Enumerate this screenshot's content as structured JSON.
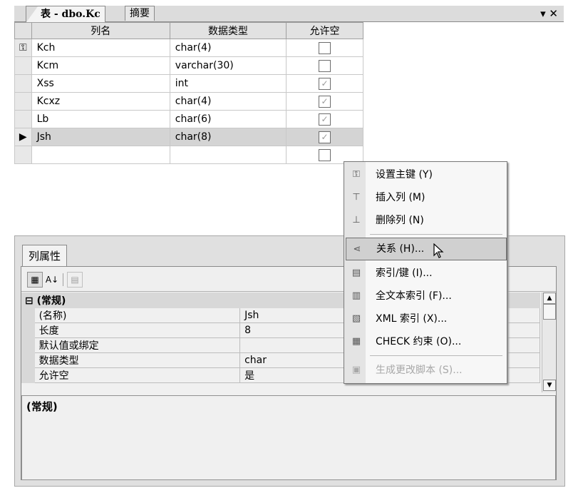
{
  "tabs": {
    "active": "表 - dbo.Kc",
    "summary": "摘要",
    "controls": "▾ ✕"
  },
  "grid": {
    "headers": [
      "列名",
      "数据类型",
      "允许空"
    ],
    "rows": [
      {
        "marker": "key",
        "name": "Kch",
        "type": "char(4)",
        "nullable": false
      },
      {
        "marker": "",
        "name": "Kcm",
        "type": "varchar(30)",
        "nullable": false
      },
      {
        "marker": "",
        "name": "Xss",
        "type": "int",
        "nullable": true
      },
      {
        "marker": "",
        "name": "Kcxz",
        "type": "char(4)",
        "nullable": true
      },
      {
        "marker": "",
        "name": "Lb",
        "type": "char(6)",
        "nullable": true
      },
      {
        "marker": "current",
        "name": "Jsh",
        "type": "char(8)",
        "nullable": true
      },
      {
        "marker": "",
        "name": "",
        "type": "",
        "nullable": false
      }
    ]
  },
  "properties": {
    "tab": "列属性",
    "category": "(常规)",
    "items": [
      {
        "name": "(名称)",
        "value": "Jsh"
      },
      {
        "name": "长度",
        "value": "8"
      },
      {
        "name": "默认值或绑定",
        "value": ""
      },
      {
        "name": "数据类型",
        "value": "char"
      },
      {
        "name": "允许空",
        "value": "是"
      }
    ],
    "description_title": "(常规)"
  },
  "context_menu": {
    "items": [
      {
        "label": "设置主键 (Y)",
        "icon": "key-icon",
        "state": "normal"
      },
      {
        "label": "插入列 (M)",
        "icon": "insert-column-icon",
        "state": "normal"
      },
      {
        "label": "删除列 (N)",
        "icon": "delete-column-icon",
        "state": "normal"
      },
      {
        "label": "关系 (H)...",
        "icon": "relationship-icon",
        "state": "hover"
      },
      {
        "label": "索引/键 (I)...",
        "icon": "index-key-icon",
        "state": "normal"
      },
      {
        "label": "全文本索引 (F)...",
        "icon": "fulltext-index-icon",
        "state": "normal"
      },
      {
        "label": "XML 索引 (X)...",
        "icon": "xml-index-icon",
        "state": "normal"
      },
      {
        "label": "CHECK 约束 (O)...",
        "icon": "check-constraint-icon",
        "state": "normal"
      },
      {
        "label": "生成更改脚本 (S)...",
        "icon": "generate-script-icon",
        "state": "disabled"
      }
    ]
  },
  "colors": {
    "grid_header": "#e2e2e2",
    "selected_row": "#d4d4d4",
    "menu_hover": "#d0d0d0"
  }
}
